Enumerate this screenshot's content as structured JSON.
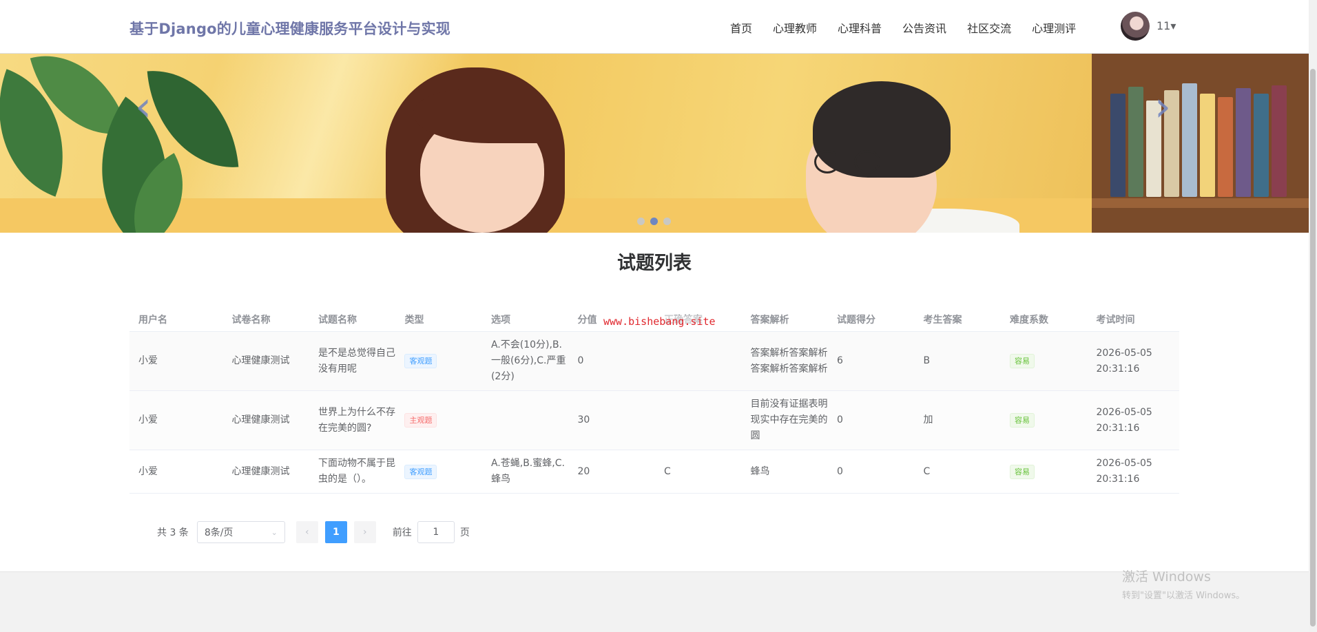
{
  "header": {
    "brand": "基于Django的儿童心理健康服务平台设计与实现",
    "nav": [
      "首页",
      "心理教师",
      "心理科普",
      "公告资讯",
      "社区交流",
      "心理测评"
    ],
    "user": "11▾"
  },
  "carousel": {
    "prev_icon": "‹",
    "next_icon": "›",
    "active_dot": 1
  },
  "section_title": "试题列表",
  "watermark": "www.bishebang.site",
  "table": {
    "columns": [
      "用户名",
      "试卷名称",
      "试题名称",
      "类型",
      "选项",
      "分值",
      "正确答案",
      "答案解析",
      "试题得分",
      "考生答案",
      "难度系数",
      "考试时间"
    ],
    "rows": [
      {
        "user": "小爱",
        "paper": "心理健康测试",
        "question": "是不是总觉得自己没有用呢",
        "type": "客观题",
        "type_color": "blue",
        "options": "A.不会(10分),B.一般(6分),C.严重(2分)",
        "score": "0",
        "answer": "",
        "analysis": "答案解析答案解析答案解析答案解析",
        "got": "6",
        "student_answer": "B",
        "difficulty": "容易",
        "time": "2026-05-05 20:31:16"
      },
      {
        "user": "小爱",
        "paper": "心理健康测试",
        "question": "世界上为什么不存在完美的圆?",
        "type": "主观题",
        "type_color": "red",
        "options": "",
        "score": "30",
        "answer": "",
        "analysis": "目前没有证据表明现实中存在完美的圆",
        "got": "0",
        "student_answer": "加",
        "difficulty": "容易",
        "time": "2026-05-05 20:31:16"
      },
      {
        "user": "小爱",
        "paper": "心理健康测试",
        "question": "下面动物不属于昆虫的是（）。",
        "type": "客观题",
        "type_color": "blue",
        "options": "A.苍蝇,B.蜜蜂,C.蜂鸟",
        "score": "20",
        "answer": "C",
        "analysis": "蜂鸟",
        "got": "0",
        "student_answer": "C",
        "difficulty": "容易",
        "time": "2026-05-05 20:31:16"
      }
    ]
  },
  "pagination": {
    "total": "共 3 条",
    "page_size": "8条/页",
    "current_page": "1",
    "goto_label": "前往",
    "goto_value": "1",
    "page_unit": "页",
    "prev_icon": "‹",
    "next_icon": "›",
    "dropdown_icon": "⌄"
  },
  "windows_activation": {
    "title": "激活 Windows",
    "subtitle": "转到\"设置\"以激活 Windows。"
  },
  "colors": {
    "brand": "#6f76a8",
    "accent": "#409eff"
  }
}
